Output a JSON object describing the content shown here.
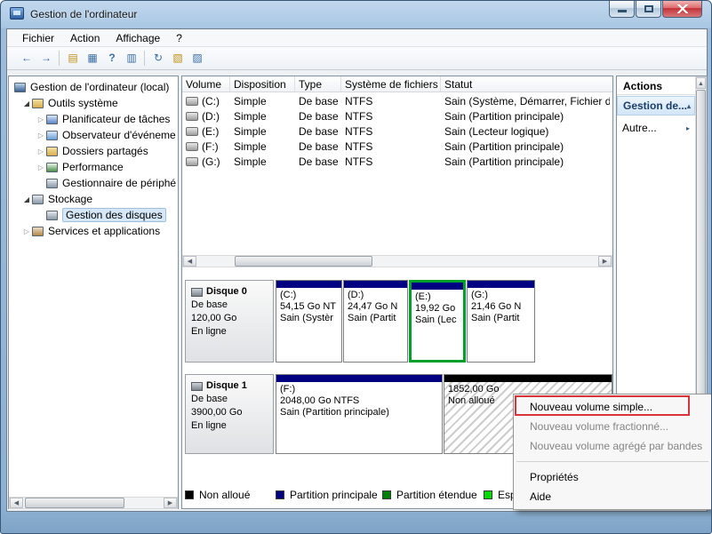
{
  "titlebar": {
    "title": "Gestion de l'ordinateur"
  },
  "menubar": {
    "items": [
      "Fichier",
      "Action",
      "Affichage",
      "?"
    ]
  },
  "toolbar": {
    "icons": [
      {
        "name": "back",
        "glyph": "←"
      },
      {
        "name": "forward",
        "glyph": "→"
      },
      {
        "name": "up-level",
        "glyph": "▤"
      },
      {
        "name": "show-console-tree",
        "glyph": "▦"
      },
      {
        "name": "help",
        "glyph": "?"
      },
      {
        "name": "show-action-pane",
        "glyph": "▥"
      },
      {
        "name": "refresh",
        "glyph": "↻"
      },
      {
        "name": "export-list",
        "glyph": "▧"
      },
      {
        "name": "disk-view",
        "glyph": "▨"
      }
    ]
  },
  "icons": {
    "expanded": "◢",
    "collapsed": "▷",
    "chevron_up": "▴",
    "flyout": "▸",
    "scroll_left": "◀",
    "scroll_right": "▶",
    "scroll_up": "▲",
    "scroll_down": "▼"
  },
  "tree": {
    "items": [
      "Gestion de l'ordinateur (local)",
      "Outils système",
      "Planificateur de tâches",
      "Observateur d'événeme",
      "Dossiers partagés",
      "Performance",
      "Gestionnaire de périphé",
      "Stockage",
      "Gestion des disques",
      "Services et applications"
    ]
  },
  "volume_list": {
    "columns": [
      "Volume",
      "Disposition",
      "Type",
      "Système de fichiers",
      "Statut"
    ],
    "rows": [
      [
        "(C:)",
        "Simple",
        "De base",
        "NTFS",
        "Sain (Système, Démarrer, Fichier d'é"
      ],
      [
        "(D:)",
        "Simple",
        "De base",
        "NTFS",
        "Sain (Partition principale)"
      ],
      [
        "(E:)",
        "Simple",
        "De base",
        "NTFS",
        "Sain (Lecteur logique)"
      ],
      [
        "(F:)",
        "Simple",
        "De base",
        "NTFS",
        "Sain (Partition principale)"
      ],
      [
        "(G:)",
        "Simple",
        "De base",
        "NTFS",
        "Sain (Partition principale)"
      ]
    ]
  },
  "disks": [
    {
      "name": "Disque 0",
      "type": "De base",
      "size": "120,00 Go",
      "status": "En ligne",
      "partitions": [
        {
          "label": "(C:)",
          "size": "54,15 Go NT",
          "status": "Sain (Systèr"
        },
        {
          "label": "(D:)",
          "size": "24,47 Go N",
          "status": "Sain (Partit"
        },
        {
          "label": "(E:)",
          "size": "19,92 Go",
          "status": "Sain (Lec"
        },
        {
          "label": "(G:)",
          "size": "21,46 Go N",
          "status": "Sain (Partit"
        }
      ]
    },
    {
      "name": "Disque 1",
      "type": "De base",
      "size": "3900,00 Go",
      "status": "En ligne",
      "partitions": [
        {
          "label": "(F:)",
          "size": "2048,00 Go NTFS",
          "status": "Sain (Partition principale)"
        },
        {
          "label": "",
          "size": "1852,00 Go",
          "status": "Non alloué"
        }
      ]
    }
  ],
  "legend": [
    {
      "label": "Non alloué",
      "color": "#000000"
    },
    {
      "label": "Partition principale",
      "color": "#000082"
    },
    {
      "label": "Partition étendue",
      "color": "#008000"
    },
    {
      "label": "Espace",
      "color": "#00dc00"
    }
  ],
  "actions_panel": {
    "title": "Actions",
    "groups": [
      {
        "label": "Gestion de..."
      },
      {
        "label": "Autre..."
      }
    ]
  },
  "context_menu": {
    "items": [
      {
        "label": "Nouveau volume simple...",
        "enabled": true,
        "annotated": true
      },
      {
        "label": "Nouveau volume fractionné...",
        "enabled": false
      },
      {
        "label": "Nouveau volume agrégé par bandes",
        "enabled": false
      },
      {
        "label": "Propriétés",
        "enabled": true
      },
      {
        "label": "Aide",
        "enabled": true
      }
    ]
  },
  "colors": {
    "primary_partition": "#000082",
    "unallocated_strip": "#000000",
    "extended_selection": "#00a02a",
    "annotation_red": "#d93438"
  }
}
